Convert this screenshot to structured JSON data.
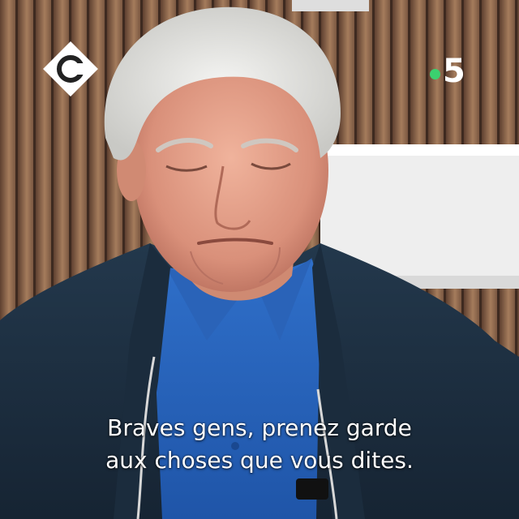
{
  "channel_logo": {
    "text": "5",
    "dot_color": "#3bd16f"
  },
  "show_logo": {
    "icon": "c-a-vous-logo-icon"
  },
  "subtitle": {
    "line1": "Braves gens, prenez garde",
    "line2": "aux choses que vous dites."
  }
}
